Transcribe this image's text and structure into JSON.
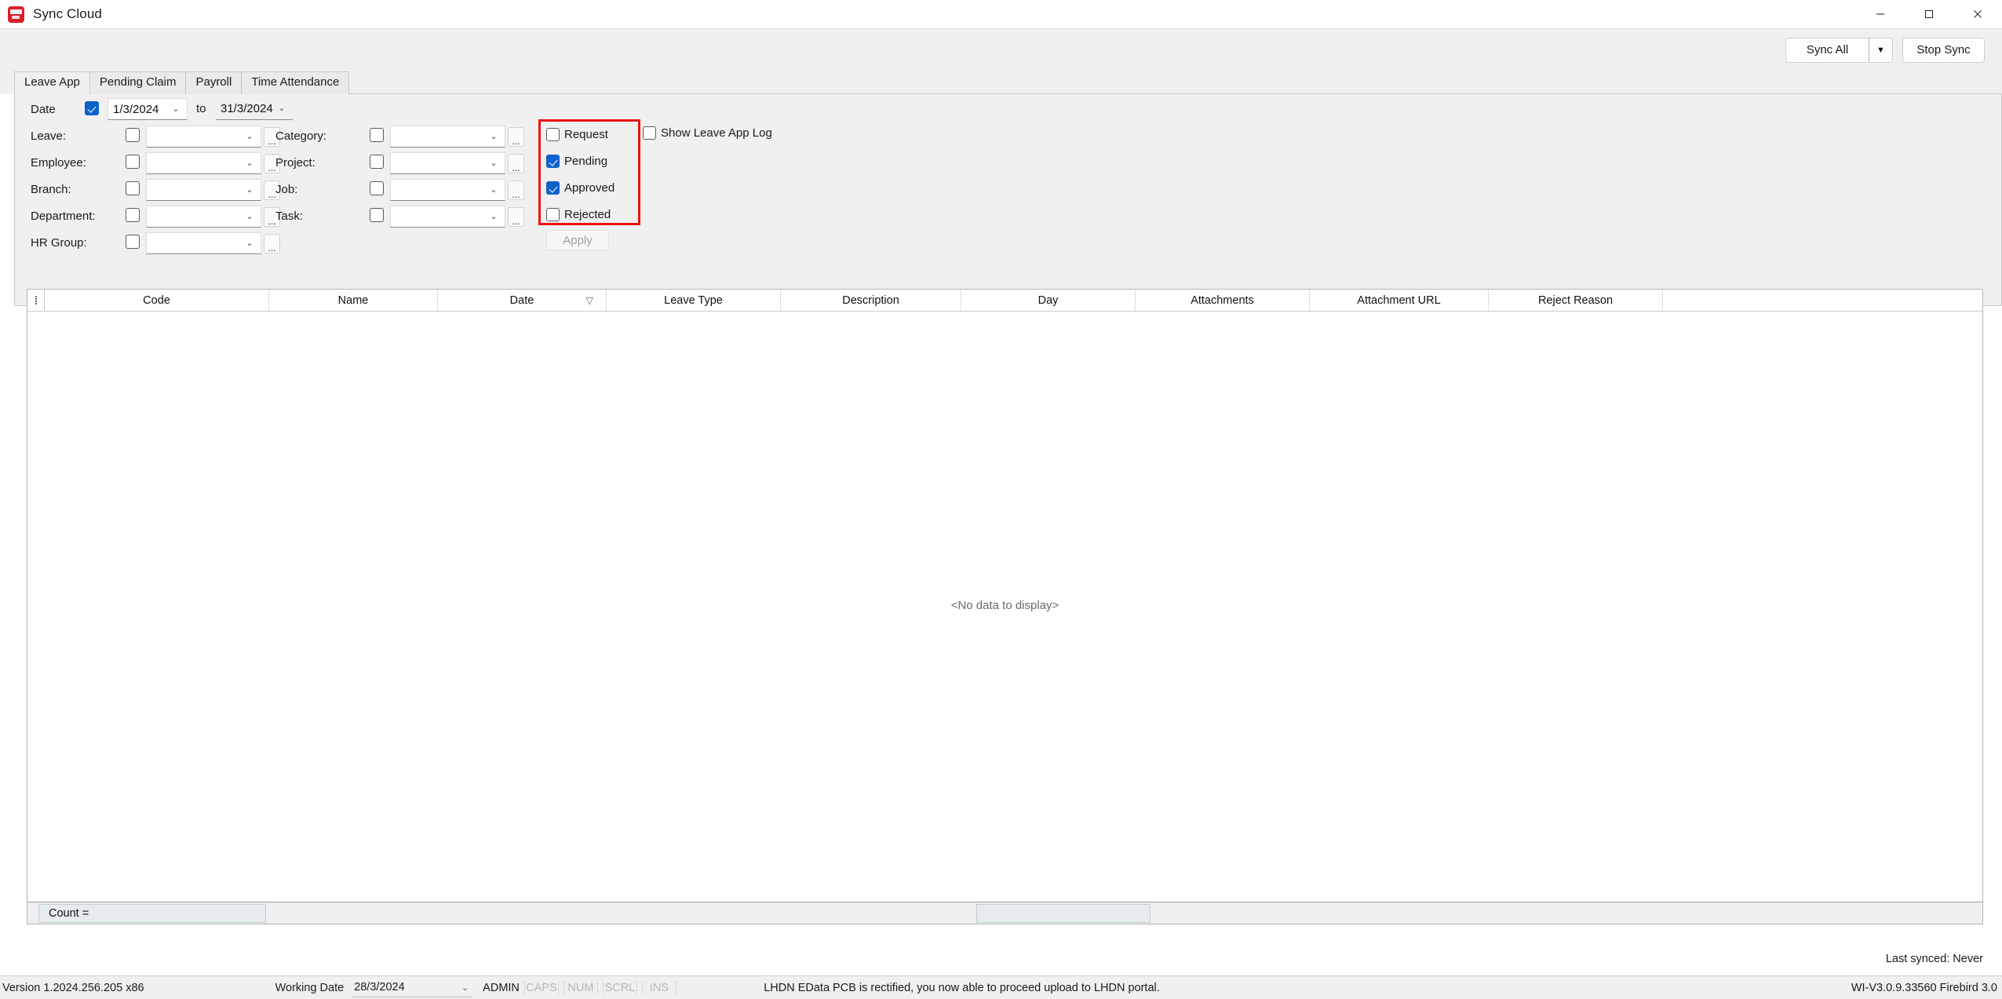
{
  "window": {
    "title": "Sync Cloud",
    "icon": "app-logo-icon",
    "minimize": "—",
    "maximize": "□",
    "close": "✕"
  },
  "toolbar": {
    "sync_all_label": "Sync All",
    "sync_all_arrow": "▼",
    "stop_sync_label": "Stop Sync"
  },
  "tabs": [
    {
      "label": "Leave App",
      "active": true
    },
    {
      "label": "Pending Claim",
      "active": false
    },
    {
      "label": "Payroll",
      "active": false
    },
    {
      "label": "Time Attendance",
      "active": false
    }
  ],
  "filters": {
    "date": {
      "label": "Date",
      "enabled": true,
      "from_value": "1/3/2024",
      "to_label": "to",
      "to_value": "31/3/2024"
    },
    "ellipsis_label": "...",
    "chevron": "⌄",
    "left_column": [
      {
        "label": "Leave:",
        "checked": false,
        "value": ""
      },
      {
        "label": "Employee:",
        "checked": false,
        "value": ""
      },
      {
        "label": "Branch:",
        "checked": false,
        "value": ""
      },
      {
        "label": "Department:",
        "checked": false,
        "value": ""
      },
      {
        "label": "HR Group:",
        "checked": false,
        "value": ""
      }
    ],
    "right_column": [
      {
        "label": "Category:",
        "checked": false,
        "value": ""
      },
      {
        "label": "Project:",
        "checked": false,
        "value": ""
      },
      {
        "label": "Job:",
        "checked": false,
        "value": ""
      },
      {
        "label": "Task:",
        "checked": false,
        "value": ""
      }
    ],
    "status_group": {
      "highlight_color": "#ee1111",
      "items": [
        {
          "label": "Request",
          "checked": false
        },
        {
          "label": "Pending",
          "checked": true
        },
        {
          "label": "Approved",
          "checked": true
        },
        {
          "label": "Rejected",
          "checked": false
        }
      ]
    },
    "show_log": {
      "label": "Show Leave App Log",
      "checked": false
    },
    "apply_label": "Apply"
  },
  "grid": {
    "columns": [
      "Code",
      "Name",
      "Date",
      "Leave Type",
      "Description",
      "Day",
      "Attachments",
      "Attachment URL",
      "Reject Reason"
    ],
    "sort_column": "Date",
    "sort_mark": "▽",
    "empty_message": "<No data to display>",
    "footer_count_label": "Count =",
    "footer_secondary": ""
  },
  "sync_status": "Last synced: Never",
  "statusbar": {
    "version": "Version 1.2024.256.205 x86",
    "working_date_label": "Working Date",
    "working_date_value": "28/3/2024",
    "user": "ADMIN",
    "indicators": [
      "CAPS",
      "NUM",
      "SCRL",
      "INS"
    ],
    "message": "LHDN EData PCB is rectified, you now able to proceed upload to LHDN portal.",
    "build": "WI-V3.0.9.33560 Firebird 3.0"
  }
}
